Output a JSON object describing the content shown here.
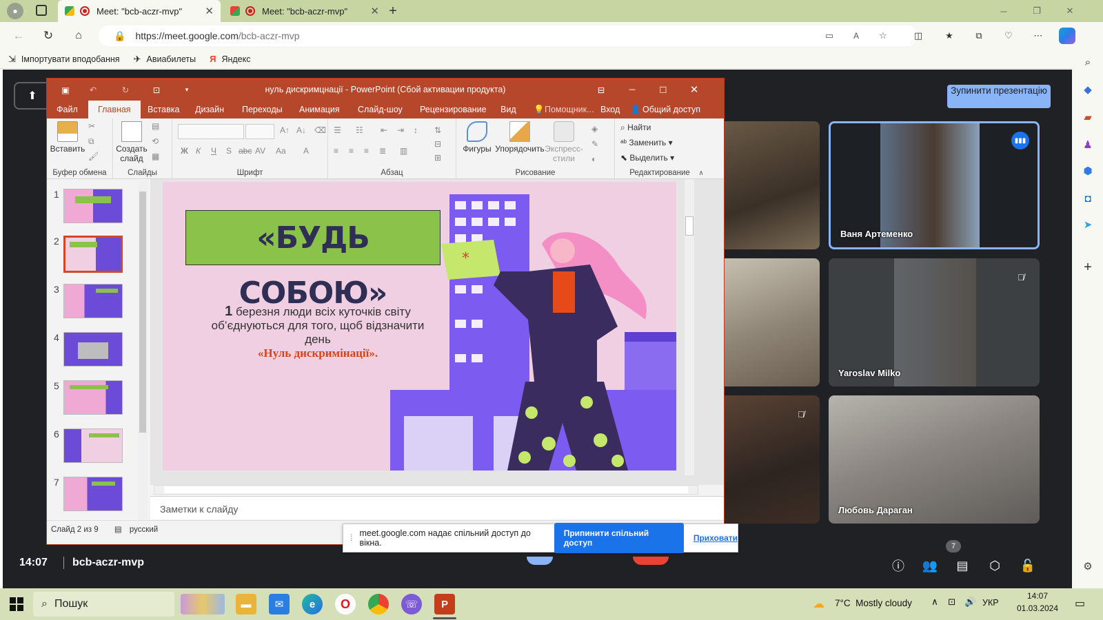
{
  "browser": {
    "tabs": [
      {
        "title": "Meet: \"bcb-aczr-mvp\""
      },
      {
        "title": "Meet: \"bcb-aczr-mvp\""
      }
    ],
    "url_host": "https://meet.google.com",
    "url_path": "/bcb-aczr-mvp",
    "bookmarks": [
      {
        "label": "Імпортувати вподобання"
      },
      {
        "label": "Авиабилеты"
      },
      {
        "label": "Яндекс"
      }
    ]
  },
  "powerpoint": {
    "title": "нуль дискримцнації - PowerPoint (Сбой активации продукта)",
    "menu": {
      "file": "Файл",
      "home": "Главная",
      "insert": "Вставка",
      "design": "Дизайн",
      "transitions": "Переходы",
      "animation": "Анимация",
      "slideshow": "Слайд-шоу",
      "review": "Рецензирование",
      "view": "Вид",
      "assistant": "Помощник...",
      "login": "Вход",
      "share": "Общий доступ"
    },
    "ribbon": {
      "paste": "Вставить",
      "clipboard": "Буфер обмена",
      "new_slide_1": "Создать",
      "new_slide_2": "слайд",
      "slides": "Слайды",
      "font": "Шрифт",
      "paragraph": "Абзац",
      "shapes": "Фигуры",
      "arrange": "Упорядочить",
      "quick_styles_1": "Экспресс-",
      "quick_styles_2": "стили",
      "drawing": "Рисование",
      "find": "Найти",
      "replace": "Заменить",
      "select": "Выделить",
      "editing": "Редактирование"
    },
    "thumbs": [
      "1",
      "2",
      "3",
      "4",
      "5",
      "6",
      "7"
    ],
    "slide": {
      "title": "«БУДЬ СОБОЮ»",
      "num": "1",
      "line1": " березня люди всіх куточків світу",
      "line2": "об’єднуються для того, щоб відзначити",
      "line3": "день",
      "emph": "«Нуль дискримінації»."
    },
    "notes": "Заметки к слайду",
    "status_slide": "Слайд 2 из 9",
    "status_lang": "русский"
  },
  "meet": {
    "stop_presenting": "Зупинити презентацію",
    "participants": [
      {
        "name": "Ваня Артеменко"
      },
      {
        "name": "Yaroslav Milko"
      },
      {
        "name": "Любовь Дараган"
      }
    ],
    "time": "14:07",
    "code": "bcb-aczr-mvp",
    "people_count": "7",
    "share_notice": "meet.google.com надає спільний доступ до вікна.",
    "share_stop": "Припинити спільний доступ",
    "share_hide": "Приховати"
  },
  "taskbar": {
    "search": "Пошук",
    "weather": "7°C  Mostly cloudy",
    "lang": "УКР",
    "time": "14:07",
    "date": "01.03.2024"
  },
  "colors": {
    "ppt": "#b7472a",
    "meet_bg": "#202124",
    "accent": "#1a73e8"
  }
}
